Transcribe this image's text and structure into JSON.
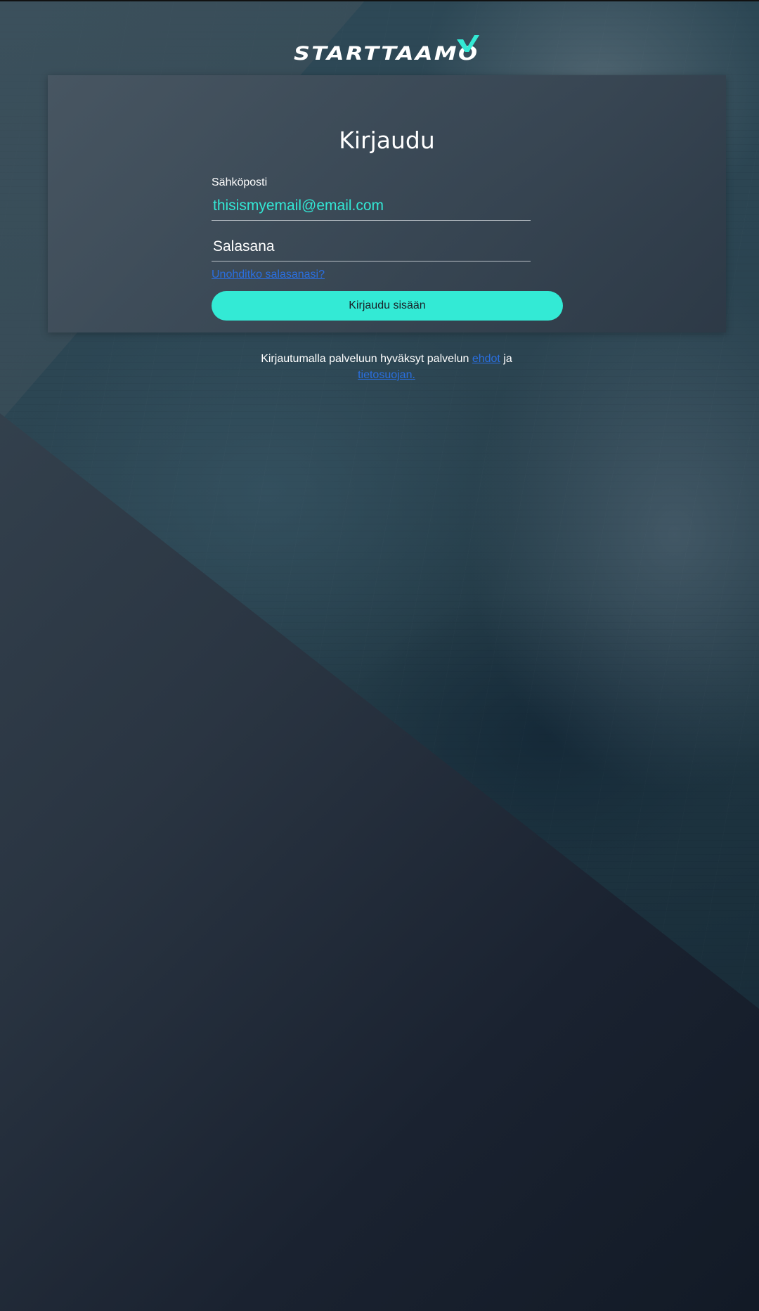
{
  "brand": {
    "name": "STARTTAAMO",
    "accent_color": "#33ead5"
  },
  "login": {
    "title": "Kirjaudu",
    "email_label": "Sähköposti",
    "email_value": "thisismyemail@email.com",
    "password_placeholder": "Salasana",
    "forgot_password": "Unohditko salasanasi?",
    "submit_label": "Kirjaudu sisään"
  },
  "terms": {
    "prefix": "Kirjautumalla palveluun hyväksyt palvelun",
    "terms_link": "ehdot",
    "conjunction": "ja",
    "privacy_link": "tietosuojan."
  },
  "colors": {
    "link": "#2a6fe0",
    "email_text": "#33e6d4",
    "button_bg": "#33ead5"
  }
}
